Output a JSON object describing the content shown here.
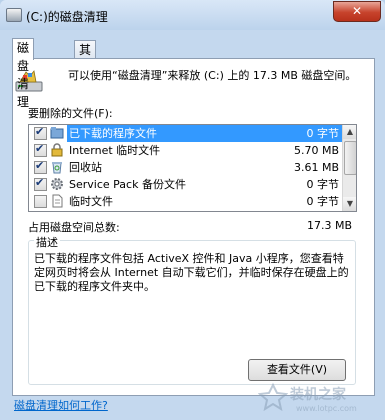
{
  "window": {
    "title": "(C:)的磁盘清理",
    "close_label": "✕"
  },
  "tabs": [
    {
      "label": "磁盘清理"
    },
    {
      "label": "其他选项"
    }
  ],
  "summary": "可以使用“磁盘清理”来释放 (C:) 上的 17.3 MB 磁盘空间。",
  "files_label": "要删除的文件(F):",
  "files": [
    {
      "name": "已下载的程序文件",
      "size": "0 字节",
      "checked": true,
      "selected": true,
      "icon": "folder-icon"
    },
    {
      "name": "Internet 临时文件",
      "size": "5.70 MB",
      "checked": true,
      "selected": false,
      "icon": "lock-icon"
    },
    {
      "name": "回收站",
      "size": "3.61 MB",
      "checked": true,
      "selected": false,
      "icon": "recycle-bin-icon"
    },
    {
      "name": "Service Pack 备份文件",
      "size": "0 字节",
      "checked": true,
      "selected": false,
      "icon": "gear-icon"
    },
    {
      "name": "临时文件",
      "size": "0 字节",
      "checked": false,
      "selected": false,
      "icon": "document-icon"
    }
  ],
  "total": {
    "label": "占用磁盘空间总数:",
    "value": "17.3 MB"
  },
  "description": {
    "legend": "描述",
    "text": "已下载的程序文件包括 ActiveX 控件和 Java 小程序，您查看特定网页时将会从 Internet 自动下载它们，并临时保存在硬盘上的已下载的程序文件夹中。"
  },
  "view_files_button": "查看文件(V)",
  "help_link": "磁盘清理如何工作?",
  "watermark": {
    "text": "装机之家",
    "url": "www.lotpc.com"
  }
}
